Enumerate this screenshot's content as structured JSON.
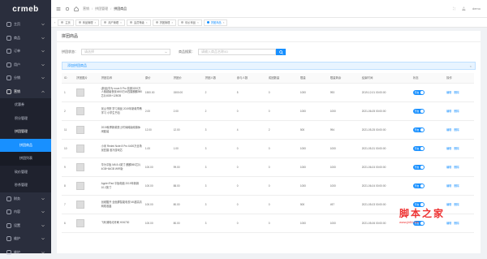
{
  "brand": {
    "logo": "crmeb"
  },
  "sidebar": {
    "items": [
      {
        "label": "主页",
        "icon": "home-icon"
      },
      {
        "label": "商品",
        "icon": "goods-icon"
      },
      {
        "label": "订单",
        "icon": "order-icon"
      },
      {
        "label": "用户",
        "icon": "user-icon"
      },
      {
        "label": "分销",
        "icon": "share-icon"
      },
      {
        "label": "营销",
        "icon": "marketing-icon"
      }
    ],
    "marketing_children": [
      {
        "label": "优惠券"
      },
      {
        "label": "积分管理"
      },
      {
        "label": "拼团管理"
      }
    ],
    "group_children": [
      {
        "label": "拼团商品",
        "active": true
      },
      {
        "label": "拼团列表"
      }
    ],
    "more_children": [
      {
        "label": "砍价管理"
      },
      {
        "label": "秒杀管理"
      }
    ],
    "bottom_items": [
      {
        "label": "财务",
        "icon": "finance-icon"
      },
      {
        "label": "内容",
        "icon": "content-icon"
      },
      {
        "label": "设置",
        "icon": "settings-icon"
      },
      {
        "label": "维护",
        "icon": "maintain-icon"
      },
      {
        "label": "维护",
        "icon": "maintain-icon"
      }
    ]
  },
  "topbar": {
    "breadcrumbs": [
      "营销",
      "拼团管理",
      "拼团商品"
    ],
    "right_text": "demo"
  },
  "tabs": [
    "主页",
    "商品管理",
    "用户管理",
    "会员等级",
    "拼团管理",
    "砍价商品",
    "拼团商品"
  ],
  "page": {
    "title": "拼团商品",
    "filter_status_label": "拼团状态：",
    "filter_status_placeholder": "请选择",
    "filter_search_label": "商品搜索：",
    "filter_search_placeholder": "请输入商品名称/ID",
    "tip": "添加拼团商品"
  },
  "table": {
    "headers": [
      "ID",
      "拼团图片",
      "拼团名称",
      "原价",
      "拼团价",
      "拼团人数",
      "参与人数",
      "成团数量",
      "限量",
      "限量剩余",
      "结束时间",
      "状态",
      "操作"
    ],
    "rows": [
      {
        "id": "1",
        "name": "(新品)华为 nova 5 Pro 前置3200万人像超级夜景4800万AI四摄麒麟980芯片8GB+128GB",
        "price": "1500.00",
        "group_price": "1500.00",
        "people": "2",
        "joined": "5",
        "done": "0",
        "limit": "1000",
        "remain": "993",
        "end": "2019-12-01 00:00:00",
        "status": "开启"
      },
      {
        "id": "2",
        "name": "景山书院 学习用品 2019年新款早教学习 小学生书包",
        "price": "2.00",
        "group_price": "2.00",
        "people": "2",
        "joined": "0",
        "done": "0",
        "limit": "1000",
        "remain": "1000",
        "end": "2021-06-05 00:00:00",
        "status": "开启"
      },
      {
        "id": "11",
        "name": "2019秋季新款男士时尚韩版纯棉休闲套装",
        "price": "12.00",
        "group_price": "12.00",
        "people": "3",
        "joined": "4",
        "done": "2",
        "limit": "500",
        "remain": "994",
        "end": "2021-05-25 00:00:00",
        "status": "开启"
      },
      {
        "id": "10",
        "name": "小米 Redmi Note 8 Pro 6400万全场景四摄 液冷游戏芯",
        "price": "1.00",
        "group_price": "1.00",
        "people": "3",
        "joined": "0",
        "done": "0",
        "limit": "1000",
        "remain": "1000",
        "end": "2021-05-31 00:00:00",
        "status": "开启"
      },
      {
        "id": "9",
        "name": "华为平板 M6 8.4英寸 麒麟980芯片 4GB+64GB WiFi版",
        "price": "100.00",
        "group_price": "99.00",
        "people": "3",
        "joined": "0",
        "done": "0",
        "limit": "1000",
        "remain": "1000",
        "end": "2021-06-04 00:00:00",
        "status": "开启"
      },
      {
        "id": "8",
        "name": "Apple iPad 平板电脑 2019年新款 10.2英寸",
        "price": "100.00",
        "group_price": "88.00",
        "people": "3",
        "joined": "0",
        "done": "0",
        "limit": "1000",
        "remain": "1000",
        "end": "2021-06-04 00:00:00",
        "status": "开启"
      },
      {
        "id": "7",
        "name": "创维酷开 全面屏智能电视 4K超高清网络液晶",
        "price": "100.00",
        "group_price": "80.00",
        "people": "3",
        "joined": "0",
        "done": "0",
        "limit": "500",
        "remain": "497",
        "end": "2021-05-03 00:00:00",
        "status": "开启"
      },
      {
        "id": "6",
        "name": "飞利浦电动牙刷 HX6730",
        "price": "100.00",
        "group_price": "80.00",
        "people": "3",
        "joined": "0",
        "done": "0",
        "limit": "1000",
        "remain": "1000",
        "end": "2021-05-06 00:00:00",
        "status": "开启"
      }
    ],
    "action_edit": "编辑",
    "action_delete": "删除"
  },
  "watermark": {
    "text": "脚本之家",
    "url": "www.jb51.net"
  }
}
